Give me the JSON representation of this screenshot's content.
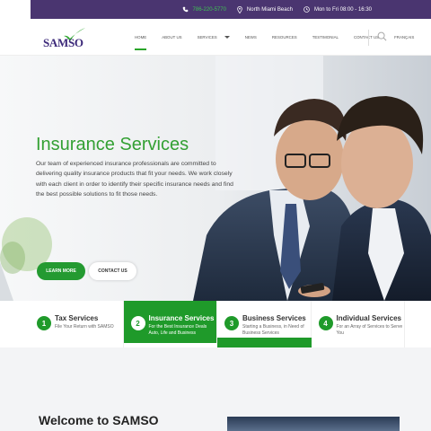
{
  "topbar": {
    "phone": "786-220-5770",
    "location": "North Miami Beach",
    "hours": "Mon to Fri 08:00 - 16:30"
  },
  "header": {
    "logo_text": "SAMSO",
    "nav": [
      "HOME",
      "ABOUT US",
      "SERVICES",
      "NEWS",
      "RESOURCES",
      "TESTIMONIAL",
      "CONTACT US",
      "FRANÇAIS"
    ],
    "active_nav": "HOME"
  },
  "hero": {
    "title": "Insurance Services",
    "text": "Our team of experienced insurance professionals are committed to delivering quality insurance products that fit your needs.  We work closely with each client in order to identify their specific insurance needs and find the best possible solutions to fit those needs.",
    "learn_more": "LEARN MORE",
    "contact_us": "CONTACT US"
  },
  "services": [
    {
      "num": "1",
      "title": "Tax Services",
      "sub": "File Your Return with SAMSO"
    },
    {
      "num": "2",
      "title": "Insurance Services",
      "sub": "For the Best Insurance Deals Auto, Life and Business"
    },
    {
      "num": "3",
      "title": "Business Services",
      "sub": "Starting a Business, in Need of Business Services"
    },
    {
      "num": "4",
      "title": "Individual Services",
      "sub": "For an Array of Services to Serve You"
    }
  ],
  "welcome": {
    "title": "Welcome to SAMSO"
  },
  "colors": {
    "brand_purple": "#4a3570",
    "brand_green": "#1f9a2a",
    "accent_green": "#3ec453"
  }
}
